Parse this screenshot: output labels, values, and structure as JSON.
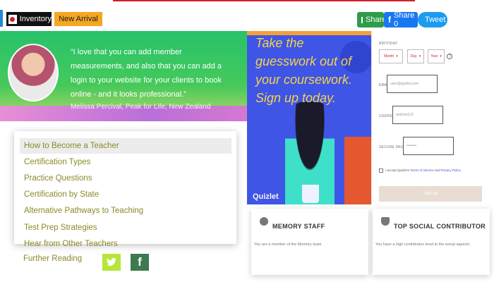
{
  "topbar": {
    "tab_inventory": "Inventory",
    "tab_new_arrival": "New Arrival",
    "share_mail_label": "Share",
    "share_facebook_label": "Share 0",
    "share_twitter_label": "Tweet"
  },
  "testimonial": {
    "quote": "“I love that you can add member measurements, and also that you can add a login to your website for your clients to book online - and it looks professional.”",
    "author": "Melissa Percival, Peak for Life, New Zealand"
  },
  "photo": {
    "heading": "Take the guesswork out of your coursework. Sign up today.",
    "brand": "Quizlet"
  },
  "signup_form": {
    "birthday_label": "BIRTHDAY",
    "month_value": "Month",
    "day_value": "Day",
    "year_value": "Year",
    "help_label": "?",
    "email_label": "EMAIL",
    "email_placeholder": "user@quizlet.com",
    "username_label": "USERNAME",
    "username_placeholder": "andrew123",
    "password_label": "SECURE PASSWORD",
    "password_value": "••••••••",
    "agree_prefix": "I accept Quizlet's",
    "terms_link": "Terms of Service",
    "agree_and": "and",
    "privacy_link": "Privacy Policy",
    "submit_label": "Sign up"
  },
  "menu": {
    "items": [
      {
        "label": "How to Become a Teacher"
      },
      {
        "label": "Certification Types"
      },
      {
        "label": "Practice Questions"
      },
      {
        "label": "Certification by State"
      },
      {
        "label": "Alternative Pathways to Teaching"
      },
      {
        "label": "Test Prep Strategies"
      },
      {
        "label": "Hear from Other Teachers"
      }
    ],
    "further_reading": "Further Reading"
  },
  "badges": [
    {
      "title": "MEMORY STAFF",
      "desc": "You are a member of the Memory team"
    },
    {
      "title": "TOP SOCIAL CONTRIBUTOR",
      "desc": "You have a high contribution level to the social aspects"
    }
  ],
  "colors": {
    "accent_red": "#d21f2a",
    "new_arrival_orange": "#f5a623",
    "mail_green": "#2e9d4a",
    "facebook_blue": "#1877f2",
    "twitter_blue": "#1d9bf0",
    "menu_text_olive": "#8a8a2a"
  },
  "icons": [
    "japan-flag-icon",
    "mail-icon",
    "facebook-icon",
    "twitter-icon",
    "help-icon",
    "badge-icon",
    "shield-icon"
  ]
}
